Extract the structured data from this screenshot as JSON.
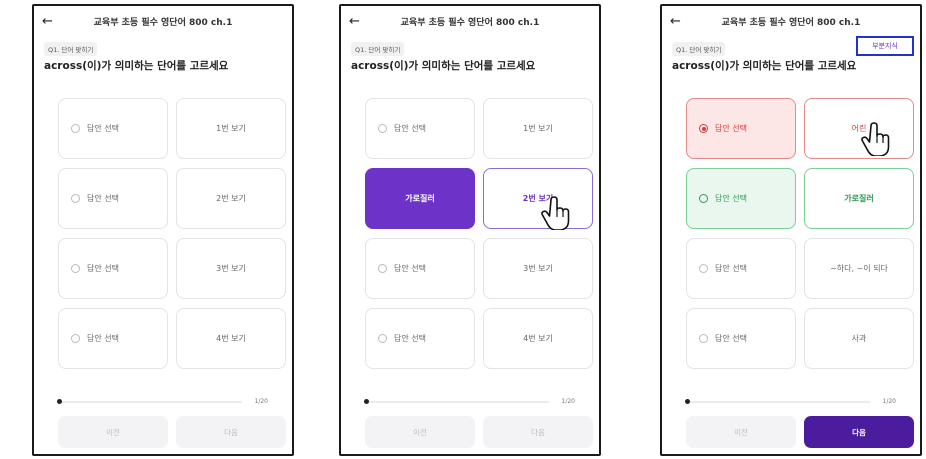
{
  "screens": [
    {
      "back_icon": "←",
      "title": "교육부 초등 필수 영단어 800 ch.1",
      "tag": "Q1. 단어 맞히기",
      "question": "across(이)가 의미하는 단어를 고르세요",
      "rows": [
        {
          "left": "답안 선택",
          "right": "1번 보기"
        },
        {
          "left": "답안 선택",
          "right": "2번 보기"
        },
        {
          "left": "답안 선택",
          "right": "3번 보기"
        },
        {
          "left": "답안 선택",
          "right": "4번 보기"
        }
      ],
      "progress": "1/20",
      "prev": "이전",
      "next": "다음"
    },
    {
      "back_icon": "←",
      "title": "교육부 초등 필수 영단어 800 ch.1",
      "tag": "Q1. 단어 맞히기",
      "question": "across(이)가 의미하는 단어를 고르세요",
      "rows": [
        {
          "left": "답안 선택",
          "right": "1번 보기"
        },
        {
          "left": "가로질러",
          "right": "2번 보기"
        },
        {
          "left": "답안 선택",
          "right": "3번 보기"
        },
        {
          "left": "답안 선택",
          "right": "4번 보기"
        }
      ],
      "progress": "1/20",
      "prev": "이전",
      "next": "다음"
    },
    {
      "back_icon": "←",
      "title": "교육부 초등 필수 영단어 800 ch.1",
      "tag": "Q1. 단어 맞히기",
      "question": "across(이)가 의미하는 단어를 고르세요",
      "explain": "부분지식",
      "rows": [
        {
          "left": "답안 선택",
          "right": "어린"
        },
        {
          "left": "답안 선택",
          "right": "가로질러"
        },
        {
          "left": "답안 선택",
          "right": "~하다, ~이 되다"
        },
        {
          "left": "답안 선택",
          "right": "사과"
        }
      ],
      "progress": "1/20",
      "prev": "이전",
      "next": "다음"
    }
  ],
  "colors": {
    "purple": "#6d33c9",
    "dark_purple": "#4b1d9e",
    "wrong_red": "#d23c3c",
    "correct_green": "#2c9a55",
    "highlight_blue": "#2233cc"
  },
  "icons": [
    "back-arrow-icon",
    "radio-icon",
    "pointer-hand-icon"
  ]
}
